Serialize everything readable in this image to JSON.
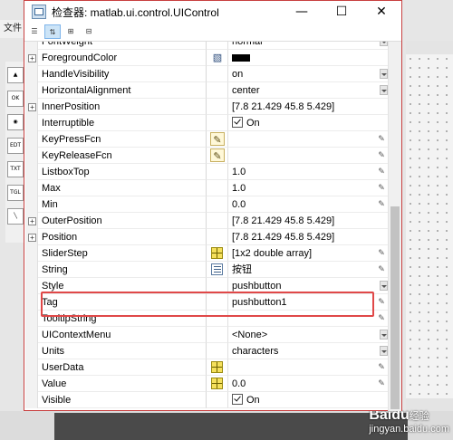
{
  "window": {
    "title": "检查器: matlab.ui.control.UIControl",
    "minimize": "—",
    "maximize": "☐",
    "close": "✕"
  },
  "background": {
    "menu_label": "文件",
    "palette_labels": [
      "OK",
      "EDT",
      "TXT",
      "TGL"
    ],
    "watermark_logo": "Baidu",
    "watermark_suffix": "经验",
    "watermark_url": "jingyan.baidu.com"
  },
  "properties": [
    {
      "name": "FontWeight",
      "value": "normal",
      "expand": false,
      "icon": "",
      "dropdown": true,
      "edit": false,
      "partial": true
    },
    {
      "name": "ForegroundColor",
      "value": "",
      "swatch": true,
      "expand": true,
      "icon": "paint",
      "dropdown": false,
      "edit": false
    },
    {
      "name": "HandleVisibility",
      "value": "on",
      "expand": false,
      "icon": "",
      "dropdown": true,
      "edit": false
    },
    {
      "name": "HorizontalAlignment",
      "value": "center",
      "expand": false,
      "icon": "",
      "dropdown": true,
      "edit": false
    },
    {
      "name": "InnerPosition",
      "value": "[7.8 21.429 45.8 5.429]",
      "expand": true,
      "icon": "",
      "dropdown": false,
      "edit": false
    },
    {
      "name": "Interruptible",
      "value": "On",
      "checkbox": true,
      "expand": false,
      "icon": "",
      "dropdown": false,
      "edit": false
    },
    {
      "name": "KeyPressFcn",
      "value": "",
      "expand": false,
      "icon": "pen",
      "dropdown": false,
      "edit": true
    },
    {
      "name": "KeyReleaseFcn",
      "value": "",
      "expand": false,
      "icon": "pen",
      "dropdown": false,
      "edit": true
    },
    {
      "name": "ListboxTop",
      "value": "1.0",
      "expand": false,
      "icon": "",
      "dropdown": false,
      "edit": true
    },
    {
      "name": "Max",
      "value": "1.0",
      "expand": false,
      "icon": "",
      "dropdown": false,
      "edit": true
    },
    {
      "name": "Min",
      "value": "0.0",
      "expand": false,
      "icon": "",
      "dropdown": false,
      "edit": true
    },
    {
      "name": "OuterPosition",
      "value": "[7.8 21.429 45.8 5.429]",
      "expand": true,
      "icon": "",
      "dropdown": false,
      "edit": false
    },
    {
      "name": "Position",
      "value": "[7.8 21.429 45.8 5.429]",
      "expand": true,
      "icon": "",
      "dropdown": false,
      "edit": false
    },
    {
      "name": "SliderStep",
      "value": "[1x2  double array]",
      "expand": false,
      "icon": "grid",
      "dropdown": false,
      "edit": true
    },
    {
      "name": "String",
      "value": "按钮",
      "expand": false,
      "icon": "text",
      "dropdown": false,
      "edit": true
    },
    {
      "name": "Style",
      "value": "pushbutton",
      "expand": false,
      "icon": "",
      "dropdown": true,
      "edit": false
    },
    {
      "name": "Tag",
      "value": "pushbutton1",
      "expand": false,
      "icon": "",
      "dropdown": false,
      "edit": true
    },
    {
      "name": "TooltipString",
      "value": "",
      "expand": false,
      "icon": "",
      "dropdown": false,
      "edit": true
    },
    {
      "name": "UIContextMenu",
      "value": "<None>",
      "expand": false,
      "icon": "",
      "dropdown": true,
      "edit": false
    },
    {
      "name": "Units",
      "value": "characters",
      "expand": false,
      "icon": "",
      "dropdown": true,
      "edit": false
    },
    {
      "name": "UserData",
      "value": "",
      "expand": false,
      "icon": "grid",
      "dropdown": false,
      "edit": true
    },
    {
      "name": "Value",
      "value": "0.0",
      "expand": false,
      "icon": "grid",
      "dropdown": false,
      "edit": true
    },
    {
      "name": "Visible",
      "value": "On",
      "checkbox": true,
      "expand": false,
      "icon": "",
      "dropdown": false,
      "edit": false
    }
  ],
  "highlighted_property": "Tag"
}
